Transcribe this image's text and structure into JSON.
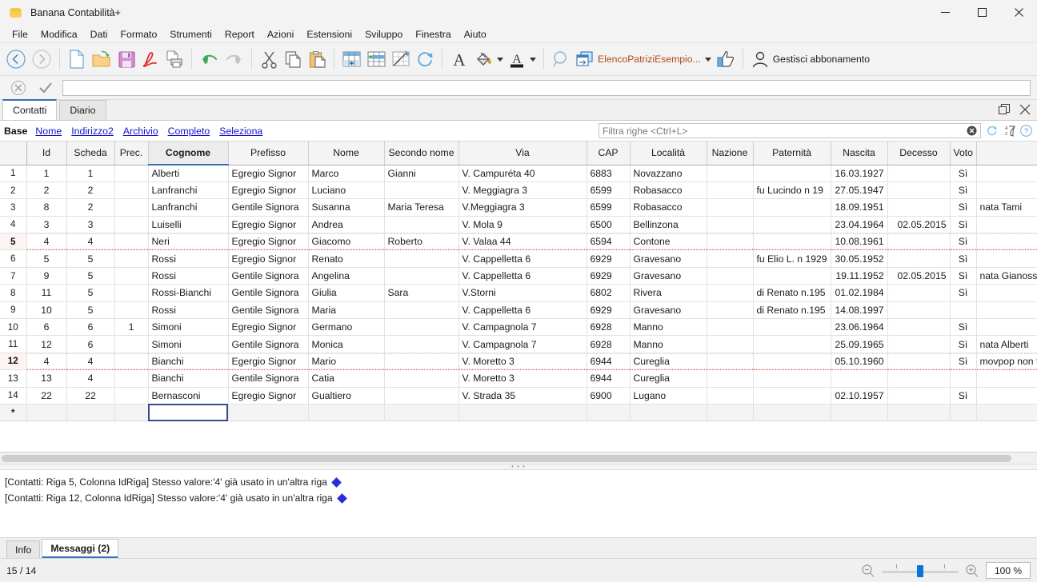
{
  "window": {
    "title": "Banana Contabilità+",
    "minimize_label": "Riduci a icona",
    "maximize_label": "Ingrandisci",
    "close_label": "Chiudi"
  },
  "menubar": {
    "items": [
      {
        "label": "File"
      },
      {
        "label": "Modifica"
      },
      {
        "label": "Dati"
      },
      {
        "label": "Formato"
      },
      {
        "label": "Strumenti"
      },
      {
        "label": "Report"
      },
      {
        "label": "Azioni"
      },
      {
        "label": "Estensioni"
      },
      {
        "label": "Sviluppo"
      },
      {
        "label": "Finestra"
      },
      {
        "label": "Aiuto"
      }
    ]
  },
  "toolbar": {
    "buttons": [
      {
        "name": "back-icon",
        "tooltip": "Indietro"
      },
      {
        "name": "forward-icon",
        "tooltip": "Avanti"
      },
      {
        "name": "new-file-icon",
        "tooltip": "Nuovo"
      },
      {
        "name": "open-folder-icon",
        "tooltip": "Apri"
      },
      {
        "name": "save-icon",
        "tooltip": "Salva"
      },
      {
        "name": "pdf-icon",
        "tooltip": "Esporta in PDF"
      },
      {
        "name": "print-icon",
        "tooltip": "Stampa"
      },
      {
        "name": "undo-icon",
        "tooltip": "Annulla"
      },
      {
        "name": "redo-icon",
        "tooltip": "Ripeti"
      },
      {
        "name": "cut-icon",
        "tooltip": "Taglia"
      },
      {
        "name": "copy-icon",
        "tooltip": "Copia"
      },
      {
        "name": "paste-icon",
        "tooltip": "Incolla"
      },
      {
        "name": "add-row-icon",
        "tooltip": "Aggiungi righe"
      },
      {
        "name": "insert-row-icon",
        "tooltip": "Inserisci righe"
      },
      {
        "name": "edit-table-icon",
        "tooltip": "Modifica tabella"
      },
      {
        "name": "refresh-icon",
        "tooltip": "Ricalcola"
      },
      {
        "name": "font-icon",
        "tooltip": "Carattere"
      },
      {
        "name": "fill-color-icon",
        "tooltip": "Colore sfondo"
      },
      {
        "name": "text-color-icon",
        "tooltip": "Colore testo"
      },
      {
        "name": "search-icon",
        "tooltip": "Trova"
      }
    ],
    "document_label": "ElencoPatriziEsempio...",
    "thumbs_up_label": "Mi piace",
    "account_label": "Gestisci abbonamento"
  },
  "formula_bar": {
    "cancel_label": "Annulla",
    "accept_label": "Conferma",
    "value": ""
  },
  "doc_tabs": {
    "tabs": [
      {
        "label": "Contatti",
        "active": true
      },
      {
        "label": "Diario",
        "active": false
      }
    ],
    "restore_label": "Ripristina",
    "close_label": "Chiudi"
  },
  "views": {
    "items": [
      {
        "label": "Base",
        "active": true
      },
      {
        "label": "Nome",
        "active": false
      },
      {
        "label": "Indirizzo2",
        "active": false
      },
      {
        "label": "Archivio",
        "active": false
      },
      {
        "label": "Completo",
        "active": false
      },
      {
        "label": "Seleziona",
        "active": false
      }
    ]
  },
  "filter": {
    "placeholder": "Filtra righe <Ctrl+L>",
    "value": "",
    "clear_label": "Cancella filtro",
    "reset_icon": "refresh-icon",
    "sort_icon": "sort-az-icon",
    "help_icon": "help-icon"
  },
  "table": {
    "columns": [
      {
        "key": "rowhdr",
        "label": "",
        "width": 33,
        "align": "center"
      },
      {
        "key": "id",
        "label": "Id",
        "width": 50,
        "align": "center"
      },
      {
        "key": "scheda",
        "label": "Scheda",
        "width": 60,
        "align": "center"
      },
      {
        "key": "prec",
        "label": "Prec.",
        "width": 42,
        "align": "center"
      },
      {
        "key": "cognome",
        "label": "Cognome",
        "width": 100,
        "align": "left",
        "selected": true
      },
      {
        "key": "prefisso",
        "label": "Prefisso",
        "width": 100,
        "align": "left"
      },
      {
        "key": "nome",
        "label": "Nome",
        "width": 95,
        "align": "left"
      },
      {
        "key": "secondo_nome",
        "label": "Secondo nome",
        "width": 93,
        "align": "left"
      },
      {
        "key": "via",
        "label": "Via",
        "width": 160,
        "align": "left"
      },
      {
        "key": "cap",
        "label": "CAP",
        "width": 54,
        "align": "left"
      },
      {
        "key": "localita",
        "label": "Località",
        "width": 96,
        "align": "left"
      },
      {
        "key": "nazione",
        "label": "Nazione",
        "width": 58,
        "align": "left"
      },
      {
        "key": "paternita",
        "label": "Paternità",
        "width": 97,
        "align": "left"
      },
      {
        "key": "nascita",
        "label": "Nascita",
        "width": 71,
        "align": "right"
      },
      {
        "key": "decesso",
        "label": "Decesso",
        "width": 78,
        "align": "right"
      },
      {
        "key": "voto",
        "label": "Voto",
        "width": 33,
        "align": "center"
      },
      {
        "key": "note",
        "label": "",
        "width": 76,
        "align": "left"
      }
    ],
    "rows": [
      {
        "rowhdr": "1",
        "id": "1",
        "scheda": "1",
        "prec": "",
        "cognome": "Alberti",
        "prefisso": "Egregio Signor",
        "nome": "Marco",
        "secondo_nome": "Gianni",
        "via": "V. Campuréta 40",
        "cap": "6883",
        "localita": "Novazzano",
        "nazione": "",
        "paternita": "",
        "nascita": "16.03.1927",
        "decesso": "",
        "voto": "Sì",
        "note": "",
        "error": false
      },
      {
        "rowhdr": "2",
        "id": "2",
        "scheda": "2",
        "prec": "",
        "cognome": "Lanfranchi",
        "prefisso": "Egregio Signor",
        "nome": "Luciano",
        "secondo_nome": "",
        "via": "V. Meggiagra 3",
        "cap": "6599",
        "localita": "Robasacco",
        "nazione": "",
        "paternita": "fu Lucindo n 19",
        "nascita": "27.05.1947",
        "decesso": "",
        "voto": "Sì",
        "note": "",
        "error": false
      },
      {
        "rowhdr": "3",
        "id": "8",
        "scheda": "2",
        "prec": "",
        "cognome": "Lanfranchi",
        "prefisso": "Gentile Signora",
        "nome": "Susanna",
        "secondo_nome": "Maria Teresa",
        "via": "V.Meggiagra 3",
        "cap": "6599",
        "localita": "Robasacco",
        "nazione": "",
        "paternita": "",
        "nascita": "18.09.1951",
        "decesso": "",
        "voto": "Sì",
        "note": "nata Tami",
        "error": false
      },
      {
        "rowhdr": "4",
        "id": "3",
        "scheda": "3",
        "prec": "",
        "cognome": "Luiselli",
        "prefisso": "Egregio Signor",
        "nome": "Andrea",
        "secondo_nome": "",
        "via": "V. Mola 9",
        "cap": "6500",
        "localita": "Bellinzona",
        "nazione": "",
        "paternita": "",
        "nascita": "23.04.1964",
        "decesso": "02.05.2015",
        "voto": "Sì",
        "note": "",
        "error": false
      },
      {
        "rowhdr": "5",
        "id": "4",
        "scheda": "4",
        "prec": "",
        "cognome": "Neri",
        "prefisso": "Egregio Signor",
        "nome": "Giacomo",
        "secondo_nome": "Roberto",
        "via": "V. Valaa 44",
        "cap": "6594",
        "localita": "Contone",
        "nazione": "",
        "paternita": "",
        "nascita": "10.08.1961",
        "decesso": "",
        "voto": "Sì",
        "note": "",
        "error": true
      },
      {
        "rowhdr": "6",
        "id": "5",
        "scheda": "5",
        "prec": "",
        "cognome": "Rossi",
        "prefisso": "Egregio Signor",
        "nome": "Renato",
        "secondo_nome": "",
        "via": "V. Cappelletta 6",
        "cap": "6929",
        "localita": "Gravesano",
        "nazione": "",
        "paternita": "fu Elio L. n 1929",
        "nascita": "30.05.1952",
        "decesso": "",
        "voto": "Sì",
        "note": "",
        "error": false
      },
      {
        "rowhdr": "7",
        "id": "9",
        "scheda": "5",
        "prec": "",
        "cognome": "Rossi",
        "prefisso": "Gentile Signora",
        "nome": "Angelina",
        "secondo_nome": "",
        "via": "V. Cappelletta 6",
        "cap": "6929",
        "localita": "Gravesano",
        "nazione": "",
        "paternita": "",
        "nascita": "19.11.1952",
        "decesso": "02.05.2015",
        "voto": "Sì",
        "note": "nata Gianossi",
        "error": false
      },
      {
        "rowhdr": "8",
        "id": "11",
        "scheda": "5",
        "prec": "",
        "cognome": "Rossi-Bianchi",
        "prefisso": "Gentile Signora",
        "nome": "Giulia",
        "secondo_nome": "Sara",
        "via": "V.Storni",
        "cap": "6802",
        "localita": "Rivera",
        "nazione": "",
        "paternita": "di Renato  n.195",
        "nascita": "01.02.1984",
        "decesso": "",
        "voto": "Sì",
        "note": "",
        "error": false
      },
      {
        "rowhdr": "9",
        "id": "10",
        "scheda": "5",
        "prec": "",
        "cognome": "Rossi",
        "prefisso": "Gentile Signora",
        "nome": "Maria",
        "secondo_nome": "",
        "via": "V. Cappelletta 6",
        "cap": "6929",
        "localita": "Gravesano",
        "nazione": "",
        "paternita": "di Renato  n.195",
        "nascita": "14.08.1997",
        "decesso": "",
        "voto": "",
        "note": "",
        "error": false
      },
      {
        "rowhdr": "10",
        "id": "6",
        "scheda": "6",
        "prec": "1",
        "cognome": "Simoni",
        "prefisso": "Egregio Signor",
        "nome": "Germano",
        "secondo_nome": "",
        "via": "V. Campagnola 7",
        "cap": "6928",
        "localita": "Manno",
        "nazione": "",
        "paternita": "",
        "nascita": "23.06.1964",
        "decesso": "",
        "voto": "Sì",
        "note": "",
        "error": false
      },
      {
        "rowhdr": "11",
        "id": "12",
        "scheda": "6",
        "prec": "",
        "cognome": "Simoni",
        "prefisso": "Gentile Signora",
        "nome": "Monica",
        "secondo_nome": "",
        "via": "V. Campagnola 7",
        "cap": "6928",
        "localita": "Manno",
        "nazione": "",
        "paternita": "",
        "nascita": "25.09.1965",
        "decesso": "",
        "voto": "Sì",
        "note": "nata Alberti",
        "error": false
      },
      {
        "rowhdr": "12",
        "id": "4",
        "scheda": "4",
        "prec": "",
        "cognome": "Bianchi",
        "prefisso": "Egergio Signor",
        "nome": "Mario",
        "secondo_nome": "",
        "via": "V. Moretto 3",
        "cap": "6944",
        "localita": "Cureglia",
        "nazione": "",
        "paternita": "",
        "nascita": "05.10.1960",
        "decesso": "",
        "voto": "Sì",
        "note": "movpop non t",
        "error": true
      },
      {
        "rowhdr": "13",
        "id": "13",
        "scheda": "4",
        "prec": "",
        "cognome": "Bianchi",
        "prefisso": "Gentile Signora",
        "nome": "Catia",
        "secondo_nome": "",
        "via": "V. Moretto 3",
        "cap": "6944",
        "localita": "Cureglia",
        "nazione": "",
        "paternita": "",
        "nascita": "",
        "decesso": "",
        "voto": "",
        "note": "",
        "error": false
      },
      {
        "rowhdr": "14",
        "id": "22",
        "scheda": "22",
        "prec": "",
        "cognome": "Bernasconi",
        "prefisso": "Egregio Signor",
        "nome": "Gualtiero",
        "secondo_nome": "",
        "via": "V. Strada 35",
        "cap": "6900",
        "localita": "Lugano",
        "nazione": "",
        "paternita": "",
        "nascita": "02.10.1957",
        "decesso": "",
        "voto": "Sì",
        "note": "",
        "error": false
      },
      {
        "rowhdr": "*",
        "id": "",
        "scheda": "",
        "prec": "",
        "cognome": "",
        "prefisso": "",
        "nome": "",
        "secondo_nome": "",
        "via": "",
        "cap": "",
        "localita": "",
        "nazione": "",
        "paternita": "",
        "nascita": "",
        "decesso": "",
        "voto": "",
        "note": "",
        "error": false,
        "is_new": true,
        "editing_cell": "cognome"
      }
    ]
  },
  "messages": {
    "lines": [
      {
        "text": "[Contatti: Riga 5, Colonna IdRiga] Stesso valore:'4' già usato in un'altra riga",
        "icon": "info-diamond-icon"
      },
      {
        "text": "[Contatti: Riga 12, Colonna IdRiga] Stesso valore:'4' già usato in un'altra riga",
        "icon": "info-diamond-icon"
      }
    ]
  },
  "bottom_tabs": {
    "tabs": [
      {
        "label": "Info",
        "active": false
      },
      {
        "label": "Messaggi (2)",
        "active": true
      }
    ]
  },
  "statusbar": {
    "row_counter": "15 / 14",
    "zoom_out_label": "Riduci zoom",
    "zoom_in_label": "Aumenta zoom",
    "zoom_value": "100 %"
  },
  "colors": {
    "accent": "#3a6fb5",
    "link": "#1414c8",
    "error": "#e05a5a",
    "document_label": "#b04a1a",
    "chrome": "#f3f3f3"
  }
}
